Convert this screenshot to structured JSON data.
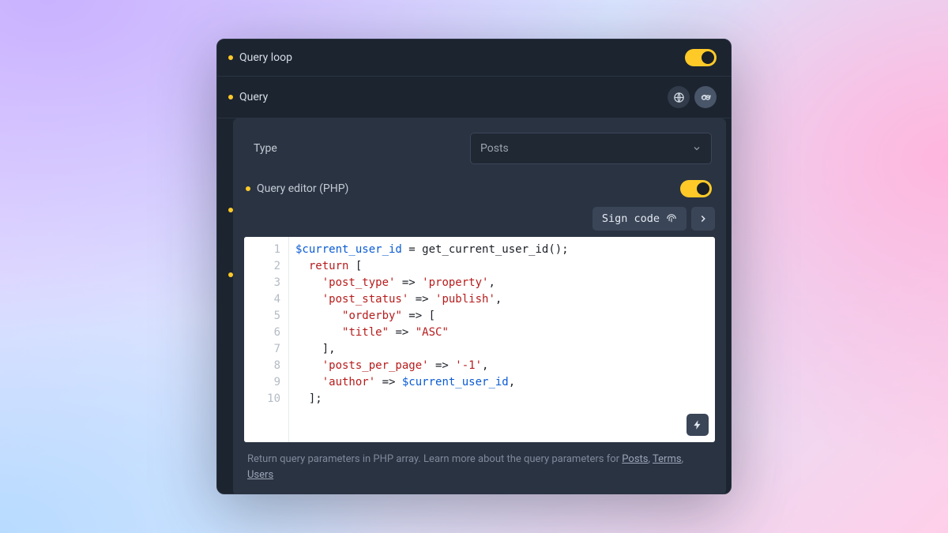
{
  "rows": {
    "query_loop": {
      "label": "Query loop"
    },
    "query": {
      "label": "Query"
    }
  },
  "type_field": {
    "label": "Type",
    "value": "Posts"
  },
  "query_editor": {
    "label": "Query editor (PHP)"
  },
  "toolbar": {
    "sign_code_label": "Sign code"
  },
  "code": {
    "line_count": 10,
    "tokens": [
      [
        {
          "t": "var",
          "v": "$current_user_id"
        },
        {
          "t": "pn",
          "v": " = "
        },
        {
          "t": "fn",
          "v": "get_current_user_id"
        },
        {
          "t": "pn",
          "v": "();"
        }
      ],
      [
        {
          "t": "pn",
          "v": "  "
        },
        {
          "t": "kw",
          "v": "return"
        },
        {
          "t": "pn",
          "v": " ["
        }
      ],
      [
        {
          "t": "pn",
          "v": "    "
        },
        {
          "t": "str",
          "v": "'post_type'"
        },
        {
          "t": "pn",
          "v": " => "
        },
        {
          "t": "str",
          "v": "'property'"
        },
        {
          "t": "pn",
          "v": ","
        }
      ],
      [
        {
          "t": "pn",
          "v": "    "
        },
        {
          "t": "str",
          "v": "'post_status'"
        },
        {
          "t": "pn",
          "v": " => "
        },
        {
          "t": "str",
          "v": "'publish'"
        },
        {
          "t": "pn",
          "v": ","
        }
      ],
      [
        {
          "t": "pn",
          "v": "       "
        },
        {
          "t": "str",
          "v": "\"orderby\""
        },
        {
          "t": "pn",
          "v": " => ["
        }
      ],
      [
        {
          "t": "pn",
          "v": "       "
        },
        {
          "t": "str",
          "v": "\"title\""
        },
        {
          "t": "pn",
          "v": " => "
        },
        {
          "t": "str",
          "v": "\"ASC\""
        }
      ],
      [
        {
          "t": "pn",
          "v": "    ],"
        }
      ],
      [
        {
          "t": "pn",
          "v": "    "
        },
        {
          "t": "str",
          "v": "'posts_per_page'"
        },
        {
          "t": "pn",
          "v": " => "
        },
        {
          "t": "str",
          "v": "'-1'"
        },
        {
          "t": "pn",
          "v": ","
        }
      ],
      [
        {
          "t": "pn",
          "v": "    "
        },
        {
          "t": "str",
          "v": "'author'"
        },
        {
          "t": "pn",
          "v": " => "
        },
        {
          "t": "var",
          "v": "$current_user_id"
        },
        {
          "t": "pn",
          "v": ","
        }
      ],
      [
        {
          "t": "pn",
          "v": "  ];"
        }
      ]
    ]
  },
  "help": {
    "text": "Return query parameters in PHP array. Learn more about the query parameters for ",
    "links": [
      "Posts",
      "Terms",
      "Users"
    ],
    "sep": ", "
  }
}
